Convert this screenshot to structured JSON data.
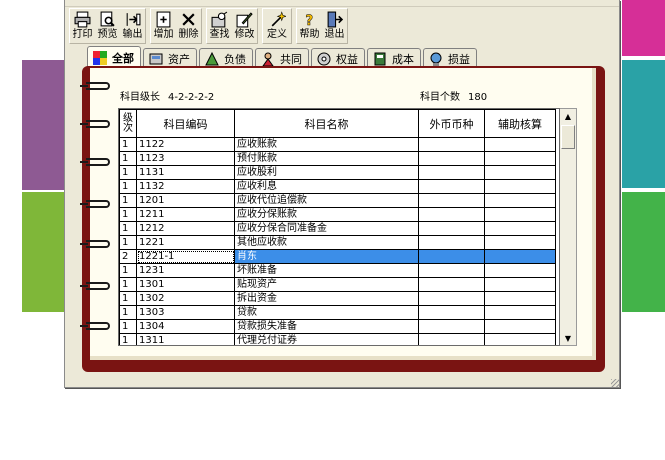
{
  "toolbar": {
    "group1": [
      {
        "label": "打印",
        "icon": "printer-icon"
      },
      {
        "label": "预览",
        "icon": "preview-icon"
      },
      {
        "label": "输出",
        "icon": "export-icon"
      }
    ],
    "group2": [
      {
        "label": "增加",
        "icon": "add-icon"
      },
      {
        "label": "删除",
        "icon": "delete-icon"
      }
    ],
    "group3": [
      {
        "label": "查找",
        "icon": "find-icon"
      },
      {
        "label": "修改",
        "icon": "edit-icon"
      }
    ],
    "group4": [
      {
        "label": "定义",
        "icon": "define-icon"
      }
    ],
    "group5": [
      {
        "label": "帮助",
        "icon": "help-icon"
      },
      {
        "label": "退出",
        "icon": "exit-icon"
      }
    ]
  },
  "tabs": [
    {
      "label": "全部",
      "active": true
    },
    {
      "label": "资产"
    },
    {
      "label": "负债"
    },
    {
      "label": "共同"
    },
    {
      "label": "权益"
    },
    {
      "label": "成本"
    },
    {
      "label": "损益"
    }
  ],
  "info": {
    "level_label": "科目级长",
    "level_value": "4-2-2-2-2",
    "count_label": "科目个数",
    "count_value": "180"
  },
  "table": {
    "headers": {
      "level_a": "级",
      "level_b": "次",
      "code": "科目编码",
      "name": "科目名称",
      "currency": "外币币种",
      "aux": "辅助核算"
    },
    "rows": [
      {
        "level": "1",
        "code": "1122",
        "name": "应收账款",
        "currency": "",
        "aux": ""
      },
      {
        "level": "1",
        "code": "1123",
        "name": "预付账款",
        "currency": "",
        "aux": ""
      },
      {
        "level": "1",
        "code": "1131",
        "name": "应收股利",
        "currency": "",
        "aux": ""
      },
      {
        "level": "1",
        "code": "1132",
        "name": "应收利息",
        "currency": "",
        "aux": ""
      },
      {
        "level": "1",
        "code": "1201",
        "name": "应收代位追偿款",
        "currency": "",
        "aux": ""
      },
      {
        "level": "1",
        "code": "1211",
        "name": "应收分保账款",
        "currency": "",
        "aux": ""
      },
      {
        "level": "1",
        "code": "1212",
        "name": "应收分保合同准备金",
        "currency": "",
        "aux": ""
      },
      {
        "level": "1",
        "code": "1221",
        "name": "其他应收款",
        "currency": "",
        "aux": ""
      },
      {
        "level": "2",
        "code": "1221-1",
        "name": "肖东",
        "currency": "",
        "aux": "",
        "selected": true
      },
      {
        "level": "1",
        "code": "1231",
        "name": "坏账准备",
        "currency": "",
        "aux": ""
      },
      {
        "level": "1",
        "code": "1301",
        "name": "贴现资产",
        "currency": "",
        "aux": ""
      },
      {
        "level": "1",
        "code": "1302",
        "name": "拆出资金",
        "currency": "",
        "aux": ""
      },
      {
        "level": "1",
        "code": "1303",
        "name": "贷款",
        "currency": "",
        "aux": ""
      },
      {
        "level": "1",
        "code": "1304",
        "name": "贷款损失准备",
        "currency": "",
        "aux": ""
      },
      {
        "level": "1",
        "code": "1311",
        "name": "代理兑付证券",
        "currency": "",
        "aux": ""
      }
    ]
  },
  "colors": {
    "selection": "#3c8ee8",
    "book_cover": "#7a1412",
    "page": "#fffdf0"
  }
}
